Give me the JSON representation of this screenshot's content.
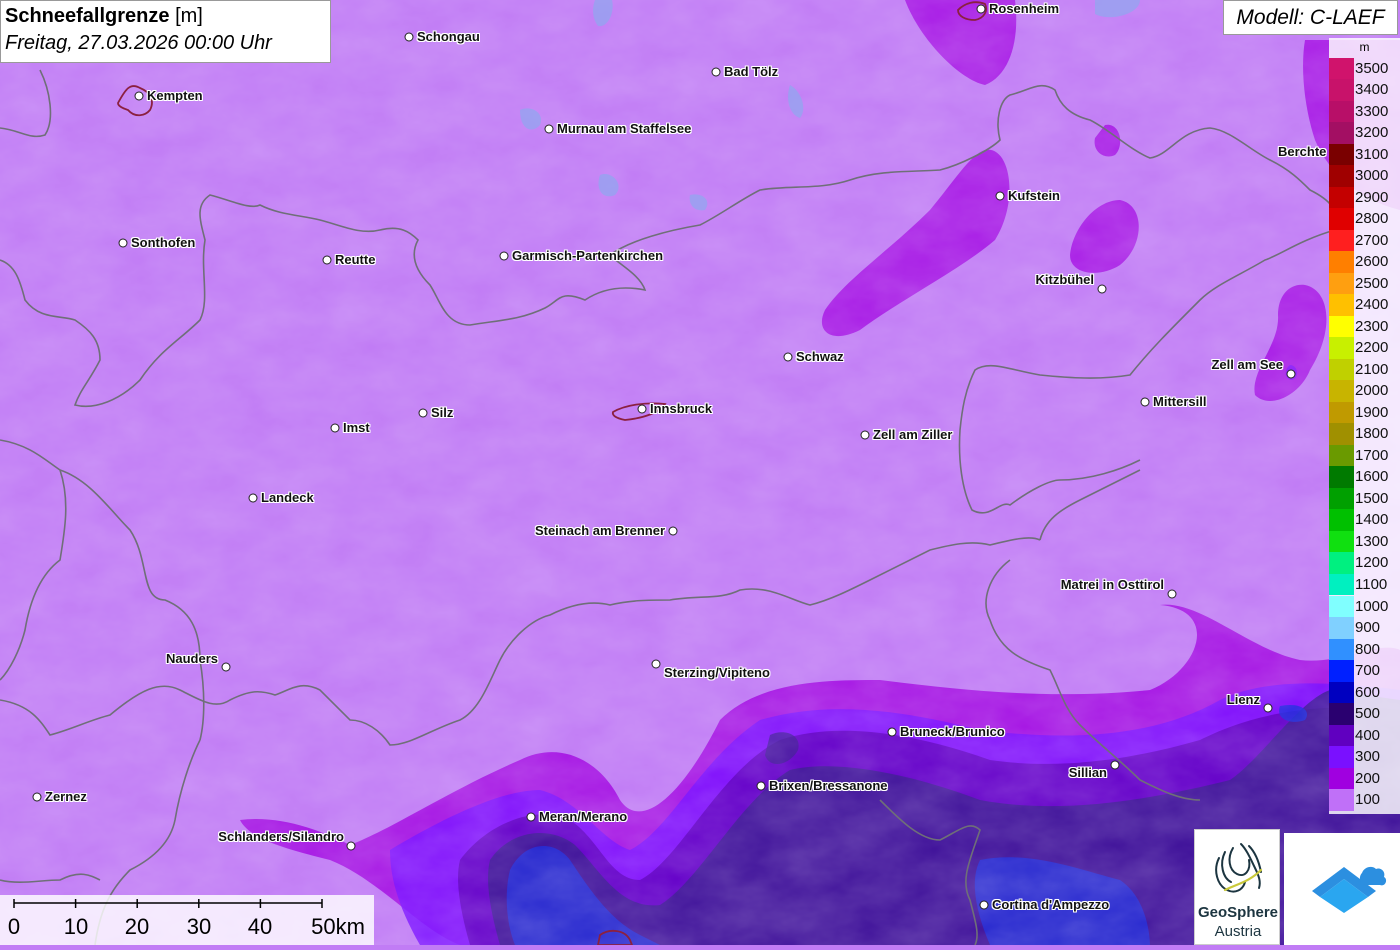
{
  "header": {
    "title": "Schneefallgrenze",
    "unit": "[m]",
    "datetime": "Freitag, 27.03.2026 00:00 Uhr"
  },
  "model": "Modell: C-LAEF",
  "legend": {
    "unit": "m",
    "levels": [
      {
        "value": "3500",
        "color": "#d0136c"
      },
      {
        "value": "3400",
        "color": "#c8126a"
      },
      {
        "value": "3300",
        "color": "#b80f68"
      },
      {
        "value": "3200",
        "color": "#a30f63"
      },
      {
        "value": "3100",
        "color": "#7a0000"
      },
      {
        "value": "3000",
        "color": "#a00000"
      },
      {
        "value": "2900",
        "color": "#c40000"
      },
      {
        "value": "2800",
        "color": "#e00000"
      },
      {
        "value": "2700",
        "color": "#ff1f1f"
      },
      {
        "value": "2600",
        "color": "#ff7f00"
      },
      {
        "value": "2500",
        "color": "#ff9f10"
      },
      {
        "value": "2400",
        "color": "#ffc000"
      },
      {
        "value": "2300",
        "color": "#ffff00"
      },
      {
        "value": "2200",
        "color": "#c8f000"
      },
      {
        "value": "2100",
        "color": "#c0d000"
      },
      {
        "value": "2000",
        "color": "#c8b400"
      },
      {
        "value": "1900",
        "color": "#c09a00"
      },
      {
        "value": "1800",
        "color": "#a09000"
      },
      {
        "value": "1700",
        "color": "#6a9a00"
      },
      {
        "value": "1600",
        "color": "#007a00"
      },
      {
        "value": "1500",
        "color": "#00a000"
      },
      {
        "value": "1400",
        "color": "#00c000"
      },
      {
        "value": "1300",
        "color": "#10e010"
      },
      {
        "value": "1200",
        "color": "#00f080"
      },
      {
        "value": "1100",
        "color": "#00f0c0"
      },
      {
        "value": "1000",
        "color": "#80ffff"
      },
      {
        "value": "900",
        "color": "#80d0ff"
      },
      {
        "value": "800",
        "color": "#3090ff"
      },
      {
        "value": "700",
        "color": "#0020ff"
      },
      {
        "value": "600",
        "color": "#0000c0"
      },
      {
        "value": "500",
        "color": "#2a0070"
      },
      {
        "value": "400",
        "color": "#6000c0"
      },
      {
        "value": "300",
        "color": "#7a10ff"
      },
      {
        "value": "200",
        "color": "#a000e0"
      },
      {
        "value": "100",
        "color": "#c070f8"
      }
    ]
  },
  "cities": [
    {
      "name": "Rosenheim"
    },
    {
      "name": "Schongau"
    },
    {
      "name": "Kempten"
    },
    {
      "name": "Bad Tölz"
    },
    {
      "name": "Murnau am Staffelsee"
    },
    {
      "name": "Berchte"
    },
    {
      "name": "Kufstein"
    },
    {
      "name": "Sonthofen"
    },
    {
      "name": "Reutte"
    },
    {
      "name": "Garmisch-Partenkirchen"
    },
    {
      "name": "Kitzbühel"
    },
    {
      "name": "Schwaz"
    },
    {
      "name": "Zell am See"
    },
    {
      "name": "Mittersill"
    },
    {
      "name": "Innsbruck"
    },
    {
      "name": "Silz"
    },
    {
      "name": "Imst"
    },
    {
      "name": "Zell am Ziller"
    },
    {
      "name": "Landeck"
    },
    {
      "name": "Steinach am Brenner"
    },
    {
      "name": "Matrei in Osttirol"
    },
    {
      "name": "Nauders"
    },
    {
      "name": "Sterzing/Vipiteno"
    },
    {
      "name": "Lienz"
    },
    {
      "name": "Bruneck/Brunico"
    },
    {
      "name": "Sillian"
    },
    {
      "name": "Brixen/Bressanone"
    },
    {
      "name": "Zernez"
    },
    {
      "name": "Meran/Merano"
    },
    {
      "name": "Schlanders/Silandro"
    },
    {
      "name": "Cortina d'Ampezzo"
    }
  ],
  "scale_bar": {
    "ticks": [
      "0",
      "10",
      "20",
      "30",
      "40",
      "50km"
    ]
  },
  "logos": {
    "geosphere_line1": "GeoSphere",
    "geosphere_line2": "Austria"
  },
  "colors": {
    "background_100m": "#c17cf5",
    "band_200m": "#a000e0",
    "band_300m": "#7a10ff",
    "band_400m": "#6000c0",
    "band_500m": "#2a0070",
    "band_700m": "#2030e0"
  }
}
